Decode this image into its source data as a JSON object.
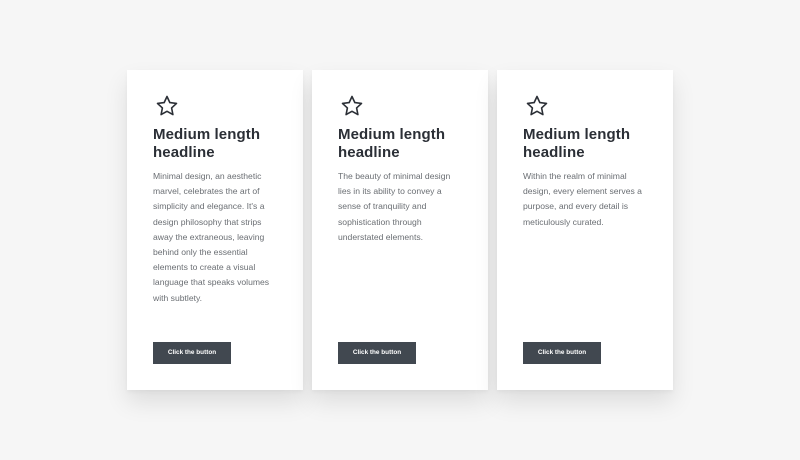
{
  "cards": [
    {
      "icon": "star-icon",
      "headline": "Medium length headline",
      "body": "Minimal design, an aesthetic marvel, celebrates the art of simplicity and elegance. It's a design philosophy that strips away the extraneous, leaving behind only the essential elements to create a visual language that speaks volumes with subtlety.",
      "button_label": "Click the button"
    },
    {
      "icon": "star-icon",
      "headline": "Medium length headline",
      "body": "The beauty of minimal design lies in its ability to convey a sense of tranquility and sophistication through understated elements.",
      "button_label": "Click the button"
    },
    {
      "icon": "star-icon",
      "headline": "Medium length headline",
      "body": "Within the realm of minimal design, every element serves a purpose, and every detail is meticulously curated.",
      "button_label": "Click the button"
    }
  ],
  "colors": {
    "page_background": "#f6f6f6",
    "card_background": "#ffffff",
    "headline_text": "#2b2f36",
    "body_text": "#6a6e73",
    "button_background": "#414850",
    "button_text": "#ffffff"
  }
}
